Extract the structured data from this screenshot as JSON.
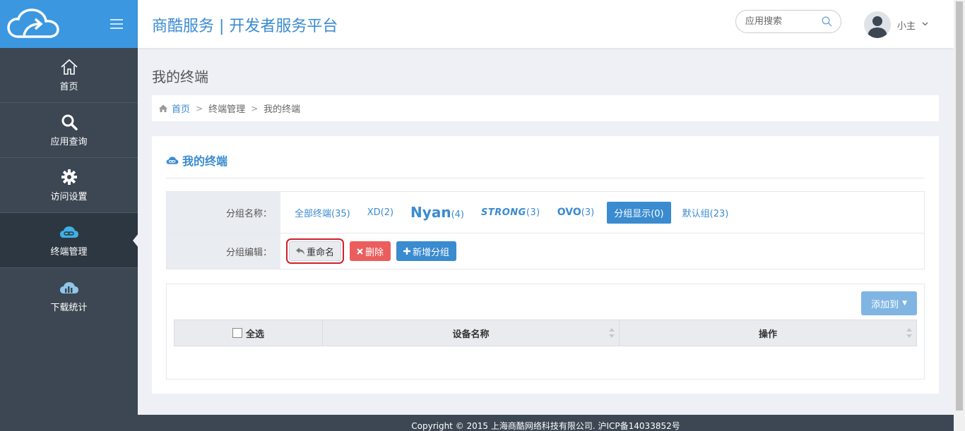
{
  "app": {
    "title": "商酷服务 | 开发者服务平台"
  },
  "sidebar": {
    "items": [
      {
        "label": "首页",
        "icon": "home-icon"
      },
      {
        "label": "应用查询",
        "icon": "search-icon"
      },
      {
        "label": "访问设置",
        "icon": "gear-icon"
      },
      {
        "label": "终端管理",
        "icon": "cloud-link-icon",
        "active": true
      },
      {
        "label": "下载统计",
        "icon": "cloud-chart-icon"
      }
    ]
  },
  "header": {
    "search_placeholder": "应用搜索",
    "user_name": "小主"
  },
  "page": {
    "title": "我的终端"
  },
  "breadcrumb": {
    "home": "首页",
    "level2": "终端管理",
    "current": "我的终端"
  },
  "card": {
    "title": "我的终端"
  },
  "groups": {
    "name_label": "分组名称：",
    "edit_label": "分组编辑：",
    "tabs": [
      {
        "name": "全部终端",
        "count": "(35)"
      },
      {
        "name": "XD",
        "count": "(2)"
      },
      {
        "name": "Nyan",
        "count": "(4)"
      },
      {
        "name": "STRONG",
        "count": "(3)"
      },
      {
        "name": "OVO",
        "count": "(3)"
      },
      {
        "name": "分组显示",
        "count": "(0)",
        "active": true
      },
      {
        "name": "默认组",
        "count": "(23)"
      }
    ],
    "rename_label": "重命名",
    "delete_label": "删除",
    "add_label": "新增分组"
  },
  "table": {
    "add_to_label": "添加到",
    "select_all_label": "全选",
    "col_device": "设备名称",
    "col_action": "操作"
  },
  "footer": {
    "text": "Copyright © 2015 上海商酷网络科技有限公司. 沪ICP备14033852号"
  },
  "colors": {
    "primary": "#3a8bd0",
    "sidebar": "#3c4753",
    "logo_bar": "#3a97e0",
    "danger": "#ea5e5e",
    "highlight_outline": "#d0202a"
  }
}
